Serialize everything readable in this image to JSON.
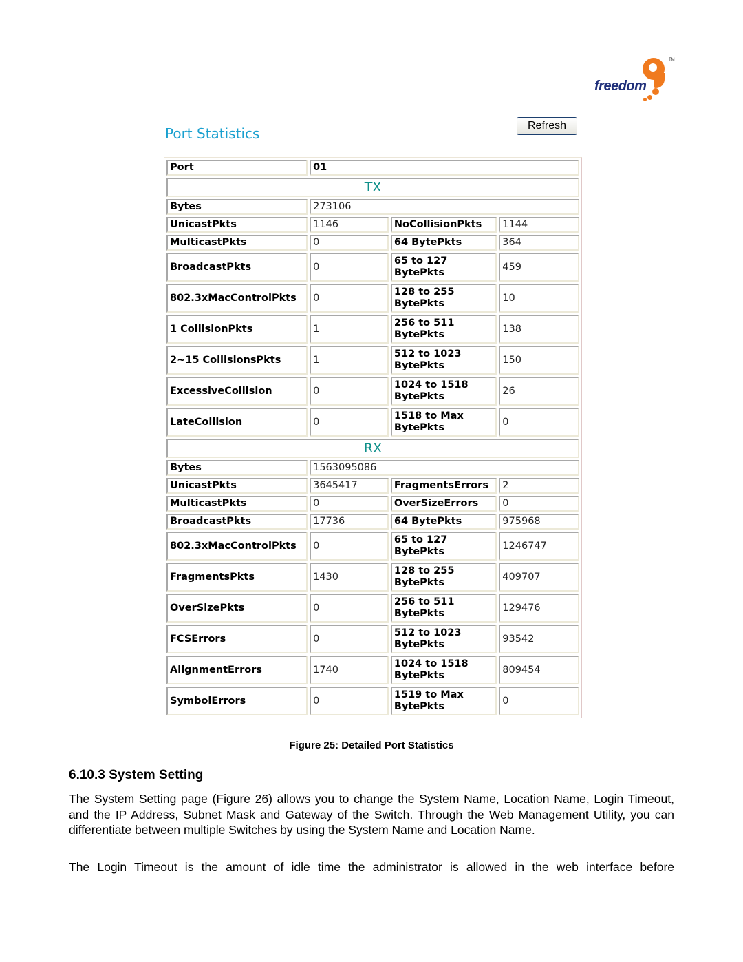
{
  "logo": {
    "text": "freedom",
    "mark": "9",
    "trademark": "TM",
    "colors": {
      "text": "#1f2f7a",
      "mark": "#f07a1e"
    }
  },
  "figure": {
    "title": "Port Statistics",
    "refresh_label": "Refresh",
    "title_color": "#1aa0cf",
    "section_color": "#10908a",
    "port_label": "Port",
    "port_value": "01",
    "tx": {
      "heading": "TX",
      "bytes_label": "Bytes",
      "bytes_value": "273106",
      "rows": [
        {
          "l1": "UnicastPkts",
          "v1": "1146",
          "l2": "NoCollisionPkts",
          "v2": "1144"
        },
        {
          "l1": "MulticastPkts",
          "v1": "0",
          "l2": "64 BytePkts",
          "v2": "364"
        },
        {
          "l1": "BroadcastPkts",
          "v1": "0",
          "l2a": "65 to 127",
          "l2b": "BytePkts",
          "v2": "459"
        },
        {
          "l1": "802.3xMacControlPkts",
          "v1": "0",
          "l2a": "128 to 255",
          "l2b": "BytePkts",
          "v2": "10"
        },
        {
          "l1": "1 CollisionPkts",
          "v1": "1",
          "l2a": "256 to 511",
          "l2b": "BytePkts",
          "v2": "138"
        },
        {
          "l1": "2~15 CollisionsPkts",
          "v1": "1",
          "l2a": "512 to 1023",
          "l2b": "BytePkts",
          "v2": "150"
        },
        {
          "l1": "ExcessiveCollision",
          "v1": "0",
          "l2a": "1024 to 1518",
          "l2b": "BytePkts",
          "v2": "26"
        },
        {
          "l1": "LateCollision",
          "v1": "0",
          "l2a": "1518 to Max",
          "l2b": "BytePkts",
          "v2": "0"
        }
      ]
    },
    "rx": {
      "heading": "RX",
      "bytes_label": "Bytes",
      "bytes_value": "1563095086",
      "rows": [
        {
          "l1": "UnicastPkts",
          "v1": "3645417",
          "l2": "FragmentsErrors",
          "v2": "2"
        },
        {
          "l1": "MulticastPkts",
          "v1": "0",
          "l2": "OverSizeErrors",
          "v2": "0"
        },
        {
          "l1": "BroadcastPkts",
          "v1": "17736",
          "l2": "64 BytePkts",
          "v2": "975968"
        },
        {
          "l1": "802.3xMacControlPkts",
          "v1": "0",
          "l2a": "65 to 127",
          "l2b": "BytePkts",
          "v2": "1246747"
        },
        {
          "l1": "FragmentsPkts",
          "v1": "1430",
          "l2a": "128 to 255",
          "l2b": "BytePkts",
          "v2": "409707"
        },
        {
          "l1": "OverSizePkts",
          "v1": "0",
          "l2a": "256 to 511",
          "l2b": "BytePkts",
          "v2": "129476"
        },
        {
          "l1": "FCSErrors",
          "v1": "0",
          "l2a": "512 to 1023",
          "l2b": "BytePkts",
          "v2": "93542"
        },
        {
          "l1": "AlignmentErrors",
          "v1": "1740",
          "l2a": "1024 to 1518",
          "l2b": "BytePkts",
          "v2": "809454"
        },
        {
          "l1": "SymbolErrors",
          "v1": "0",
          "l2a": "1519 to Max",
          "l2b": "BytePkts",
          "v2": "0"
        }
      ]
    }
  },
  "caption": "Figure 25: Detailed Port Statistics",
  "section": {
    "heading": "6.10.3 System Setting",
    "paragraph1": "The System Setting page (Figure 26) allows you to change the System Name, Location Name, Login Timeout, and the IP Address, Subnet Mask and Gateway of the Switch. Through the Web Management Utility, you can differentiate between multiple Switches by using the System Name and Location Name.",
    "paragraph2": "The Login Timeout is the amount of idle time the administrator is allowed in the web interface before"
  }
}
